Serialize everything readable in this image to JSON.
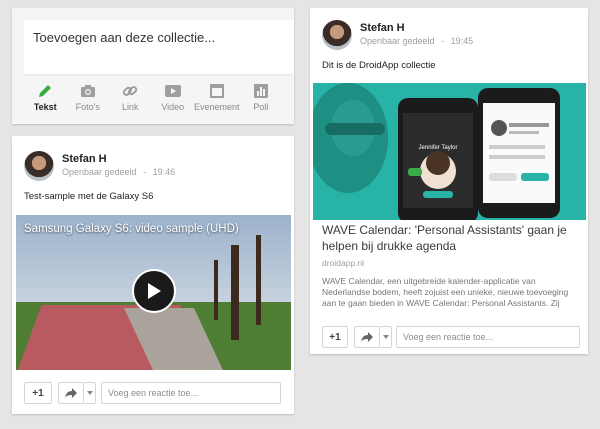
{
  "composer": {
    "placeholder": "Toevoegen aan deze collectie...",
    "tools": [
      {
        "label": "Tekst",
        "icon": "pencil-icon",
        "active": true
      },
      {
        "label": "Foto's",
        "icon": "camera-icon"
      },
      {
        "label": "Link",
        "icon": "link-icon"
      },
      {
        "label": "Video",
        "icon": "video-icon"
      },
      {
        "label": "Evenement",
        "icon": "event-icon"
      },
      {
        "label": "Poll",
        "icon": "poll-icon"
      }
    ]
  },
  "post_left": {
    "author": "Stefan H",
    "visibility": "Openbaar gedeeld",
    "time": "19:46",
    "text": "Test-sample met de Galaxy S6",
    "video_title": "Samsung Galaxy S6: video sample (UHD)",
    "plus_label": "+1",
    "reply_placeholder": "Voeg een reactie toe..."
  },
  "post_right": {
    "author": "Stefan H",
    "visibility": "Openbaar gedeeld",
    "time": "19:45",
    "text": "Dit is de DroidApp collectie",
    "link_title": "WAVE Calendar: 'Personal Assistants' gaan je helpen bij drukke agenda",
    "link_domain": "droidapp.nl",
    "link_description": "WAVE Calendar, een uitgebreide kalender-applicatie van Nederlandse bodem, heeft zojuist een unieke, nieuwe toevoeging aan te gaan bieden in WAVE Calendar: Personal Assistants. Zij zullen je helpen met het",
    "phone_name": "Jennifer Taylor",
    "plus_label": "+1",
    "reply_placeholder": "Voeg een reactie toe..."
  },
  "meta_separator": "-",
  "colors": {
    "accent_green": "#3bab4a",
    "teal": "#27b3a5"
  }
}
